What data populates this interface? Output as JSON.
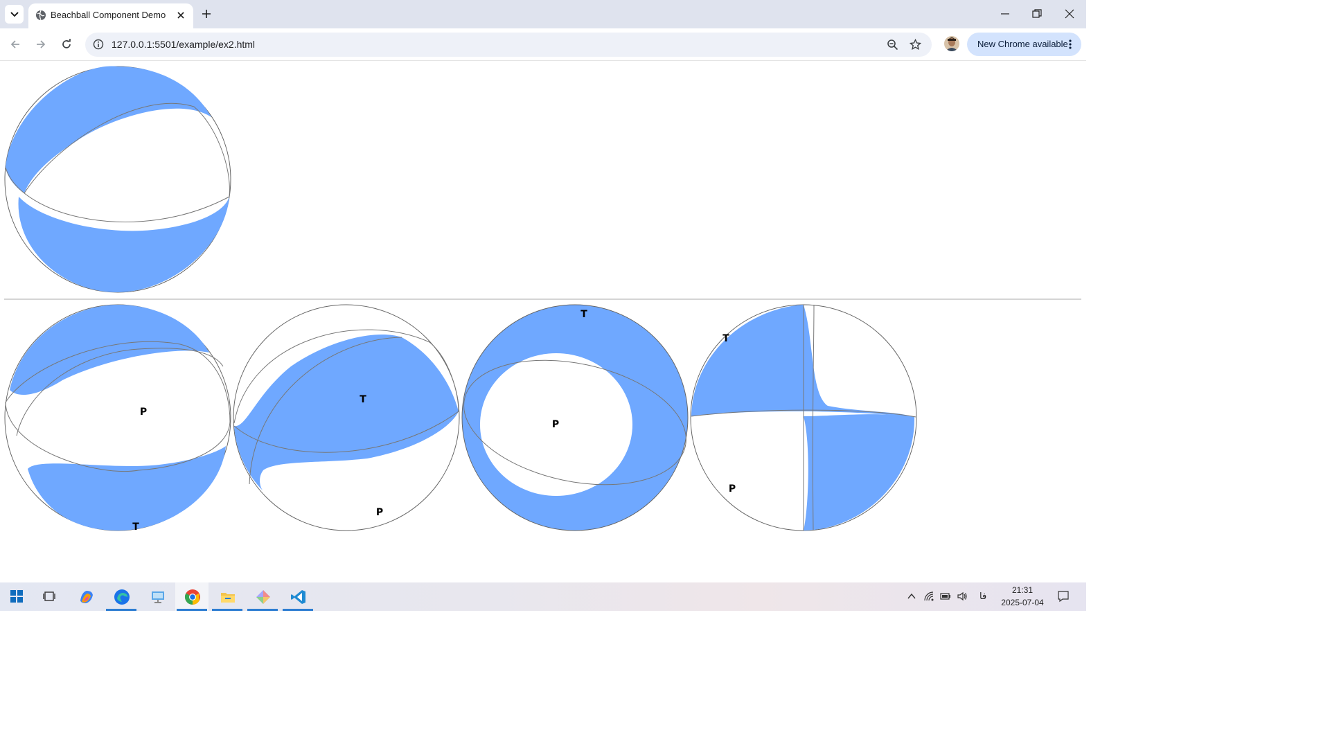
{
  "browser": {
    "tab_title": "Beachball Component Demo",
    "url": "127.0.0.1:5501/example/ex2.html",
    "update_label": "New Chrome available"
  },
  "page": {
    "fill_color": "#6fa8ff",
    "beachballs": [
      {
        "id": "ball-top",
        "labels": []
      },
      {
        "id": "ball-1",
        "labels": [
          {
            "text": "P"
          },
          {
            "text": "T"
          }
        ]
      },
      {
        "id": "ball-2",
        "labels": [
          {
            "text": "T"
          },
          {
            "text": "P"
          }
        ]
      },
      {
        "id": "ball-3",
        "labels": [
          {
            "text": "T"
          },
          {
            "text": "P"
          }
        ]
      },
      {
        "id": "ball-4",
        "labels": [
          {
            "text": "T"
          },
          {
            "text": "P"
          }
        ]
      }
    ]
  },
  "taskbar": {
    "apps": [
      "windows-start",
      "task-view",
      "copilot",
      "edge",
      "remote-desktop",
      "chrome",
      "file-explorer",
      "git-app",
      "vscode"
    ],
    "language": "فا",
    "time": "21:31",
    "date": "2025-07-04"
  }
}
